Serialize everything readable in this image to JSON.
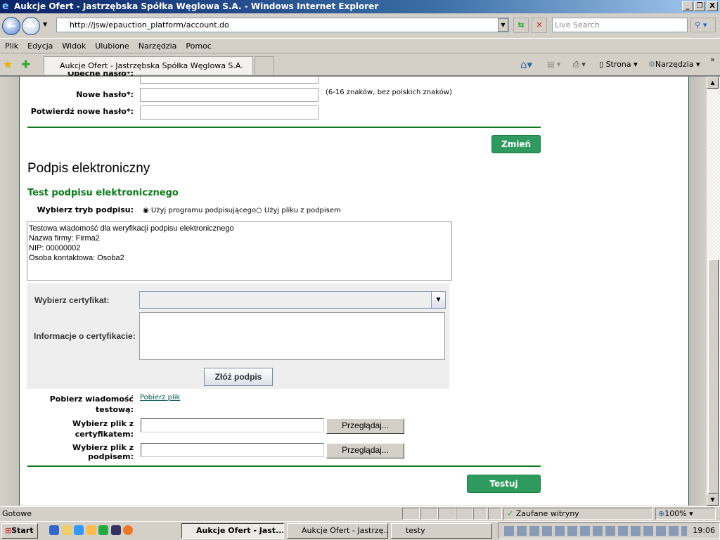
{
  "window": {
    "title": "Aukcje Ofert - Jastrzębska Spółka Węglowa S.A. - Windows Internet Explorer",
    "min": "_",
    "max": "❐",
    "close": "X"
  },
  "address": {
    "url": "http://jsw/epauction_platform/account.do",
    "search_placeholder": "Live Search"
  },
  "menu": [
    "Plik",
    "Edycja",
    "Widok",
    "Ulubione",
    "Narzędzia",
    "Pomoc"
  ],
  "tab": {
    "label": "Aukcje Ofert - Jastrzębska Spółka Węglowa S.A."
  },
  "toolbar": {
    "page": "Strona",
    "tools": "Narzędzia",
    "more": "»"
  },
  "password": {
    "current_label": "Obecne hasło*:",
    "new_label": "Nowe hasło*:",
    "hint": "(6-16 znaków, bez polskich znaków)",
    "confirm_label": "Potwierdź nowe hasło*:",
    "submit": "Zmień"
  },
  "signature": {
    "heading": "Podpis elektroniczny",
    "subheading": "Test podpisu elektronicznego",
    "mode_label": "Wybierz tryb podpisu:",
    "mode_options": [
      {
        "label": "Użyj programu podpisującego",
        "selected": true
      },
      {
        "label": "Użyj pliku z podpisem",
        "selected": false
      }
    ],
    "message_lines": [
      "Testowa wiadomość dla weryfikacji podpisu elektronicznego",
      "Nazwa firmy: Firma2",
      "NIP: 00000002",
      "Osoba kontaktowa: Osoba2"
    ],
    "cert_label": "Wybierz certyfikat:",
    "cert_value": "",
    "cert_info_label": "Informacje o certyfikacie:",
    "sign_button": "Złóż podpis",
    "download_label": "Pobierz wiadomość testową:",
    "download_link": "Pobierz plik",
    "cert_file_label": "Wybierz plik z certyfikatem:",
    "sig_file_label": "Wybierz plik z podpisem:",
    "browse": "Przeglądaj...",
    "test_button": "Testuj"
  },
  "status": {
    "text": "Gotowe",
    "zone": "Zaufane witryny",
    "zoom": "100%"
  },
  "taskbar": {
    "start": "Start",
    "tasks": [
      "Aukcje Ofert - Jast...",
      "Aukcje Ofert - Jastrzę...",
      "testy"
    ],
    "clock": "19:06"
  },
  "colors": {
    "accent_green": "#0a7a1a",
    "button_green": "#2e9a5e",
    "title_blue": "#0a246a"
  }
}
